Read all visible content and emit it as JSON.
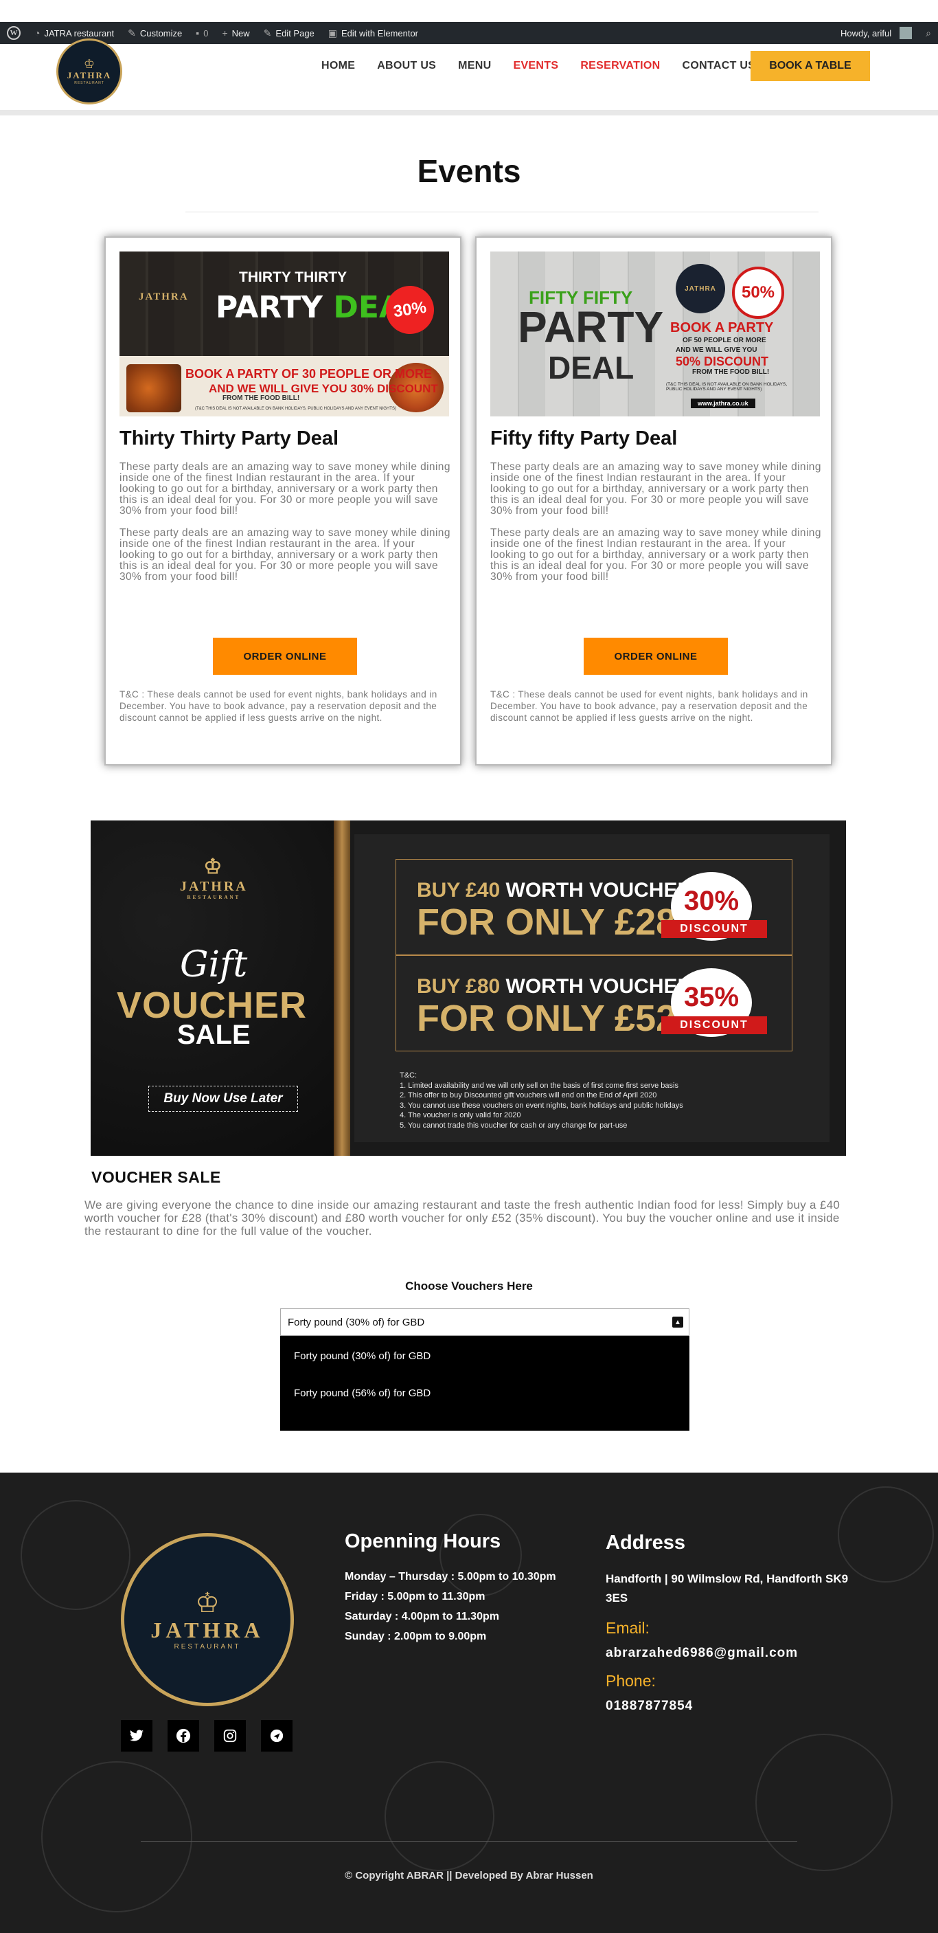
{
  "admin_bar": {
    "site_name": "JATRA restaurant",
    "customize": "Customize",
    "comments": "0",
    "new": "New",
    "edit_page": "Edit Page",
    "elementor": "Edit with Elementor",
    "howdy": "Howdy, ariful"
  },
  "header": {
    "logo": {
      "name": "JATHRA",
      "sub": "RESTAURANT"
    },
    "nav": [
      "HOME",
      "ABOUT US",
      "MENU",
      "EVENTS",
      "RESERVATION",
      "CONTACT US"
    ],
    "book_button": "BOOK A TABLE"
  },
  "events": {
    "title": "Events",
    "cards": [
      {
        "title": "Thirty Thirty Party Deal",
        "banner": {
          "logo": "JATHRA",
          "top": "THIRTY THIRTY",
          "big_a": "PARTY ",
          "big_b": "DEAL",
          "badge": "30%",
          "line1": "BOOK A PARTY OF 30 PEOPLE OR MORE",
          "line2": "AND WE WILL GIVE YOU 30% DISCOUNT",
          "line3": "FROM THE FOOD BILL!",
          "line4": "(T&C THIS DEAL IS NOT AVAILABLE ON BANK HOLIDAYS, PUBLIC HOLIDAYS AND ANY EVENT NIGHTS)"
        },
        "paragraphs": [
          "These party deals are an amazing way to save money while dining inside one of the finest Indian restaurant in the area. If your looking to go out for a birthday, anniversary or a work party then this is an ideal deal for you. For 30 or more people you will save 30% from your food bill!",
          "These party deals are an amazing way to save money while dining inside one of the finest Indian restaurant in the area. If your looking to go out for a birthday, anniversary or a work party then this is an ideal deal for you. For 30 or more people you will save 30% from your food bill!"
        ],
        "button": "ORDER ONLINE",
        "tc": "T&C : These deals cannot be used for event nights, bank holidays and in December. You have to book advance, pay a reservation deposit and the discount cannot be applied if less guests arrive on the night."
      },
      {
        "title": "Fifty fifty Party Deal",
        "banner": {
          "ff": "FIFTY FIFTY",
          "party": "PARTY",
          "deal": "DEAL",
          "logo": "JATHRA",
          "badge": "50%",
          "r1": "BOOK A PARTY",
          "r2": "OF 50 PEOPLE OR MORE",
          "r3": "AND WE WILL GIVE YOU",
          "r4": "50% DISCOUNT",
          "r5": "FROM THE FOOD BILL!",
          "r6": "(T&C THIS DEAL IS NOT AVAILABLE ON BANK HOLIDAYS, PUBLIC HOLIDAYS AND ANY EVENT NIGHTS)",
          "url": "www.jathra.co.uk"
        },
        "paragraphs": [
          "These party deals are an amazing way to save money while dining inside one of the finest Indian restaurant in the area. If your looking to go out for a birthday, anniversary or a work party then this is an ideal deal for you. For 30 or more people you will save 30% from your food bill!",
          "These party deals are an amazing way to save money while dining inside one of the finest Indian restaurant in the area. If your looking to go out for a birthday, anniversary or a work party then this is an ideal deal for you. For 30 or more people you will save 30% from your food bill!"
        ],
        "button": "ORDER ONLINE",
        "tc": "T&C : These deals cannot be used for event nights, bank holidays and in December. You have to book advance, pay a reservation deposit and the discount cannot be applied if less guests arrive on the night."
      }
    ]
  },
  "voucher_banner": {
    "logo": "JATHRA",
    "logo_sub": "RESTAURANT",
    "gift": "Gift",
    "voucher": "VOUCHER",
    "sale": "SALE",
    "buy_now": "Buy Now Use Later",
    "offers": [
      {
        "l1a": "BUY £40 ",
        "l1b": "WORTH VOUCHER",
        "l2": "FOR ONLY £28",
        "pct": "30%",
        "ribbon": "DISCOUNT"
      },
      {
        "l1a": "BUY £80 ",
        "l1b": "WORTH VOUCHER",
        "l2": "FOR ONLY £52",
        "pct": "35%",
        "ribbon": "DISCOUNT"
      }
    ],
    "tc": [
      "T&C:",
      "1. Limited availability and we will only sell on the basis of first come first serve basis",
      "2. This offer to buy Discounted gift vouchers will end on the End of April 2020",
      "3. You cannot use these vouchers on event nights, bank holidays and public holidays",
      "4. The voucher is only valid for 2020",
      "5. You cannot trade this voucher for cash or any change for part-use"
    ]
  },
  "voucher_sale": {
    "title": "VOUCHER SALE",
    "text": "We are giving everyone the chance to dine inside our amazing restaurant and taste the fresh authentic Indian food for less! Simply buy a £40 worth voucher for £28 (that's 30% discount) and £80 worth voucher for only £52 (35% discount). You buy the voucher online and use it inside the restaurant to dine for the full value of the voucher.",
    "choose_label": "Choose Vouchers Here",
    "selected": "Forty pound (30% of) for GBD",
    "options": [
      "Forty pound (30% of) for GBD",
      "Forty pound (56% of) for GBD"
    ]
  },
  "footer": {
    "logo": {
      "name": "JATHRA",
      "sub": "RESTAURANT"
    },
    "hours_title": "Openning Hours",
    "hours": [
      "Monday – Thursday : 5.00pm to 10.30pm",
      "Friday : 5.00pm to 11.30pm",
      "Saturday : 4.00pm to 11.30pm",
      "Sunday : 2.00pm to 9.00pm"
    ],
    "address_title": "Address",
    "address": "Handforth | 90 Wilmslow Rd, Handforth SK9 3ES",
    "email_label": "Email:",
    "email": "abrarzahed6986@gmail.com",
    "phone_label": "Phone:",
    "phone": "01887877854",
    "copyright": "© Copyright ABRAR || Developed By Abrar Hussen"
  },
  "colors": {
    "accent_red": "#e12b2b",
    "book_yellow": "#f6b22a",
    "order_orange": "#ff8a00",
    "footer_bg": "#1e1e1e",
    "gold": "#c9a45a"
  }
}
